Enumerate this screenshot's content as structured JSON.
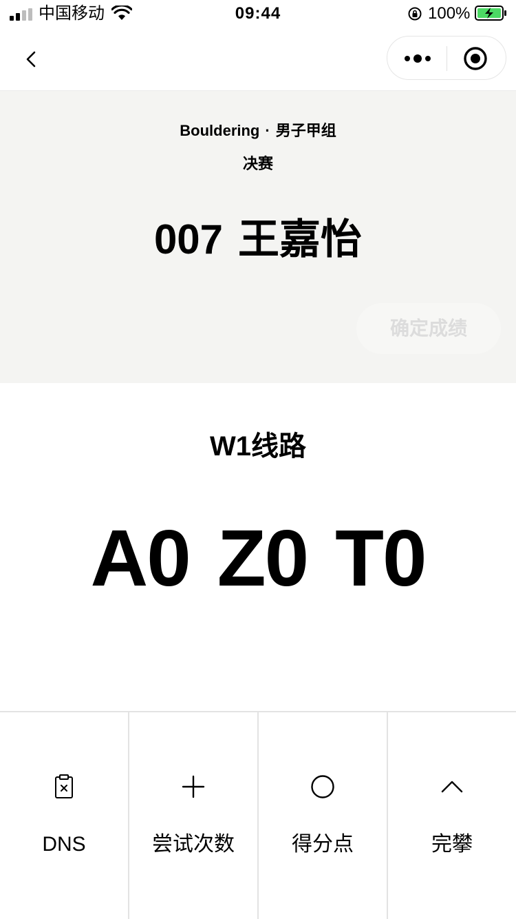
{
  "status_bar": {
    "carrier": "中国移动",
    "time": "09:44",
    "battery_percent": "100%",
    "icons": [
      "signal-icon",
      "wifi-icon",
      "rotation-lock-icon",
      "battery-charging-icon"
    ]
  },
  "nav": {
    "back_icon": "chevron-left-icon",
    "more_icon": "more-dots-icon",
    "close_icon": "target-circle-icon"
  },
  "header": {
    "discipline": "Bouldering",
    "separator": "·",
    "category": "男子甲组",
    "round": "决赛",
    "athlete_number": "007",
    "athlete_name": "王嘉怡",
    "confirm_label": "确定成绩",
    "confirm_disabled": true
  },
  "route": {
    "name": "W1线路",
    "scores": [
      "A0",
      "Z0",
      "T0"
    ]
  },
  "actions": [
    {
      "label": "DNS",
      "icon": "clipboard-x-icon"
    },
    {
      "label": "尝试次数",
      "icon": "plus-icon"
    },
    {
      "label": "得分点",
      "icon": "circle-icon"
    },
    {
      "label": "完攀",
      "icon": "chevron-up-icon"
    }
  ],
  "colors": {
    "header_bg": "#f4f4f2",
    "text": "#000000",
    "disabled_text": "#dcdcdc",
    "divider": "#e3e3e3",
    "battery_green": "#4cd964"
  }
}
